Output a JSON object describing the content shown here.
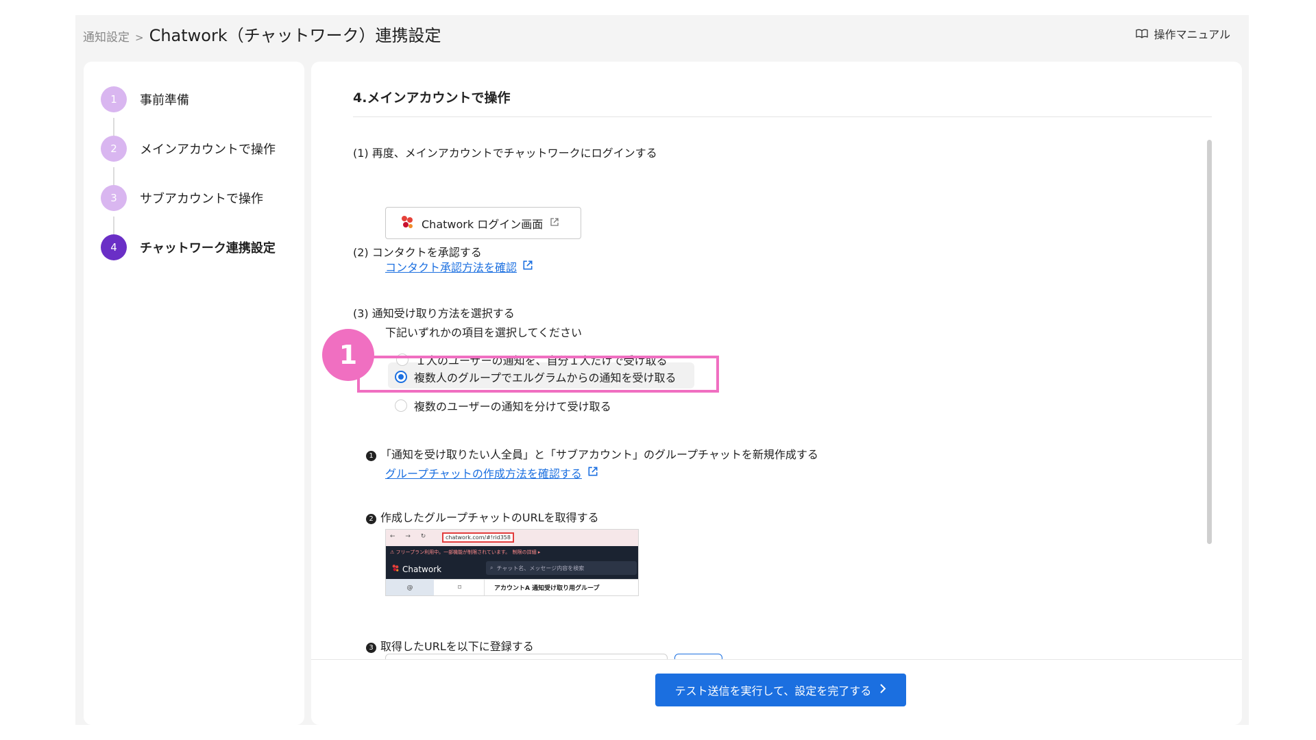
{
  "header": {
    "breadcrumb_parent": "通知設定",
    "breadcrumb_sep": ">",
    "title": "Chatwork（チャットワーク）連携設定",
    "manual_label": "操作マニュアル"
  },
  "steps": [
    {
      "num": "1",
      "label": "事前準備",
      "state": "done"
    },
    {
      "num": "2",
      "label": "メインアカウントで操作",
      "state": "done"
    },
    {
      "num": "3",
      "label": "サブアカウントで操作",
      "state": "done"
    },
    {
      "num": "4",
      "label": "チャットワーク連携設定",
      "state": "active"
    }
  ],
  "section": {
    "title": "4.メインアカウントで操作",
    "s1_label": "(1) 再度、メインアカウントでチャットワークにログインする",
    "login_button": "Chatwork ログイン画面",
    "s2_label": "(2) コンタクトを承認する",
    "s2_link": "コンタクト承認方法を確認",
    "s3_label": "(3) 通知受け取り方法を選択する",
    "s3_sub": "下記いずれかの項目を選択してください",
    "options": [
      {
        "label": "１人のユーザーの通知を、自分１人だけで受け取る",
        "selected": false
      },
      {
        "label": "複数人のグループでエルグラムからの通知を受け取る",
        "selected": true
      },
      {
        "label": "複数のユーザーの通知を分けて受け取る",
        "selected": false
      }
    ],
    "callout_number": "1",
    "step_a_bullet": "1",
    "step_a": "「通知を受け取りたい人全員」と「サブアカウント」のグループチャットを新規作成する",
    "step_a_link": "グループチャットの作成方法を確認する",
    "step_b_bullet": "2",
    "step_b": "作成したグループチャットのURLを取得する",
    "step_c_bullet": "3",
    "step_c": "取得したURLを以下に登録する"
  },
  "example_shot": {
    "url": "chatwork.com/#!rid358",
    "notice": "⚠ フリープラン利用中。一部機能が制限されています。　制限の詳細 ▸",
    "brand": "Chatwork",
    "search_placeholder": "チャット名、メッセージ内容を検索",
    "room_name": "アカウントA 通知受け取り用グループ"
  },
  "footer": {
    "submit_label": "テスト送信を実行して、設定を完了する"
  },
  "colors": {
    "accent": "#1b6fe0",
    "step_done": "#d9b6f0",
    "step_active": "#6a2fc6",
    "callout": "#f06fc1"
  }
}
